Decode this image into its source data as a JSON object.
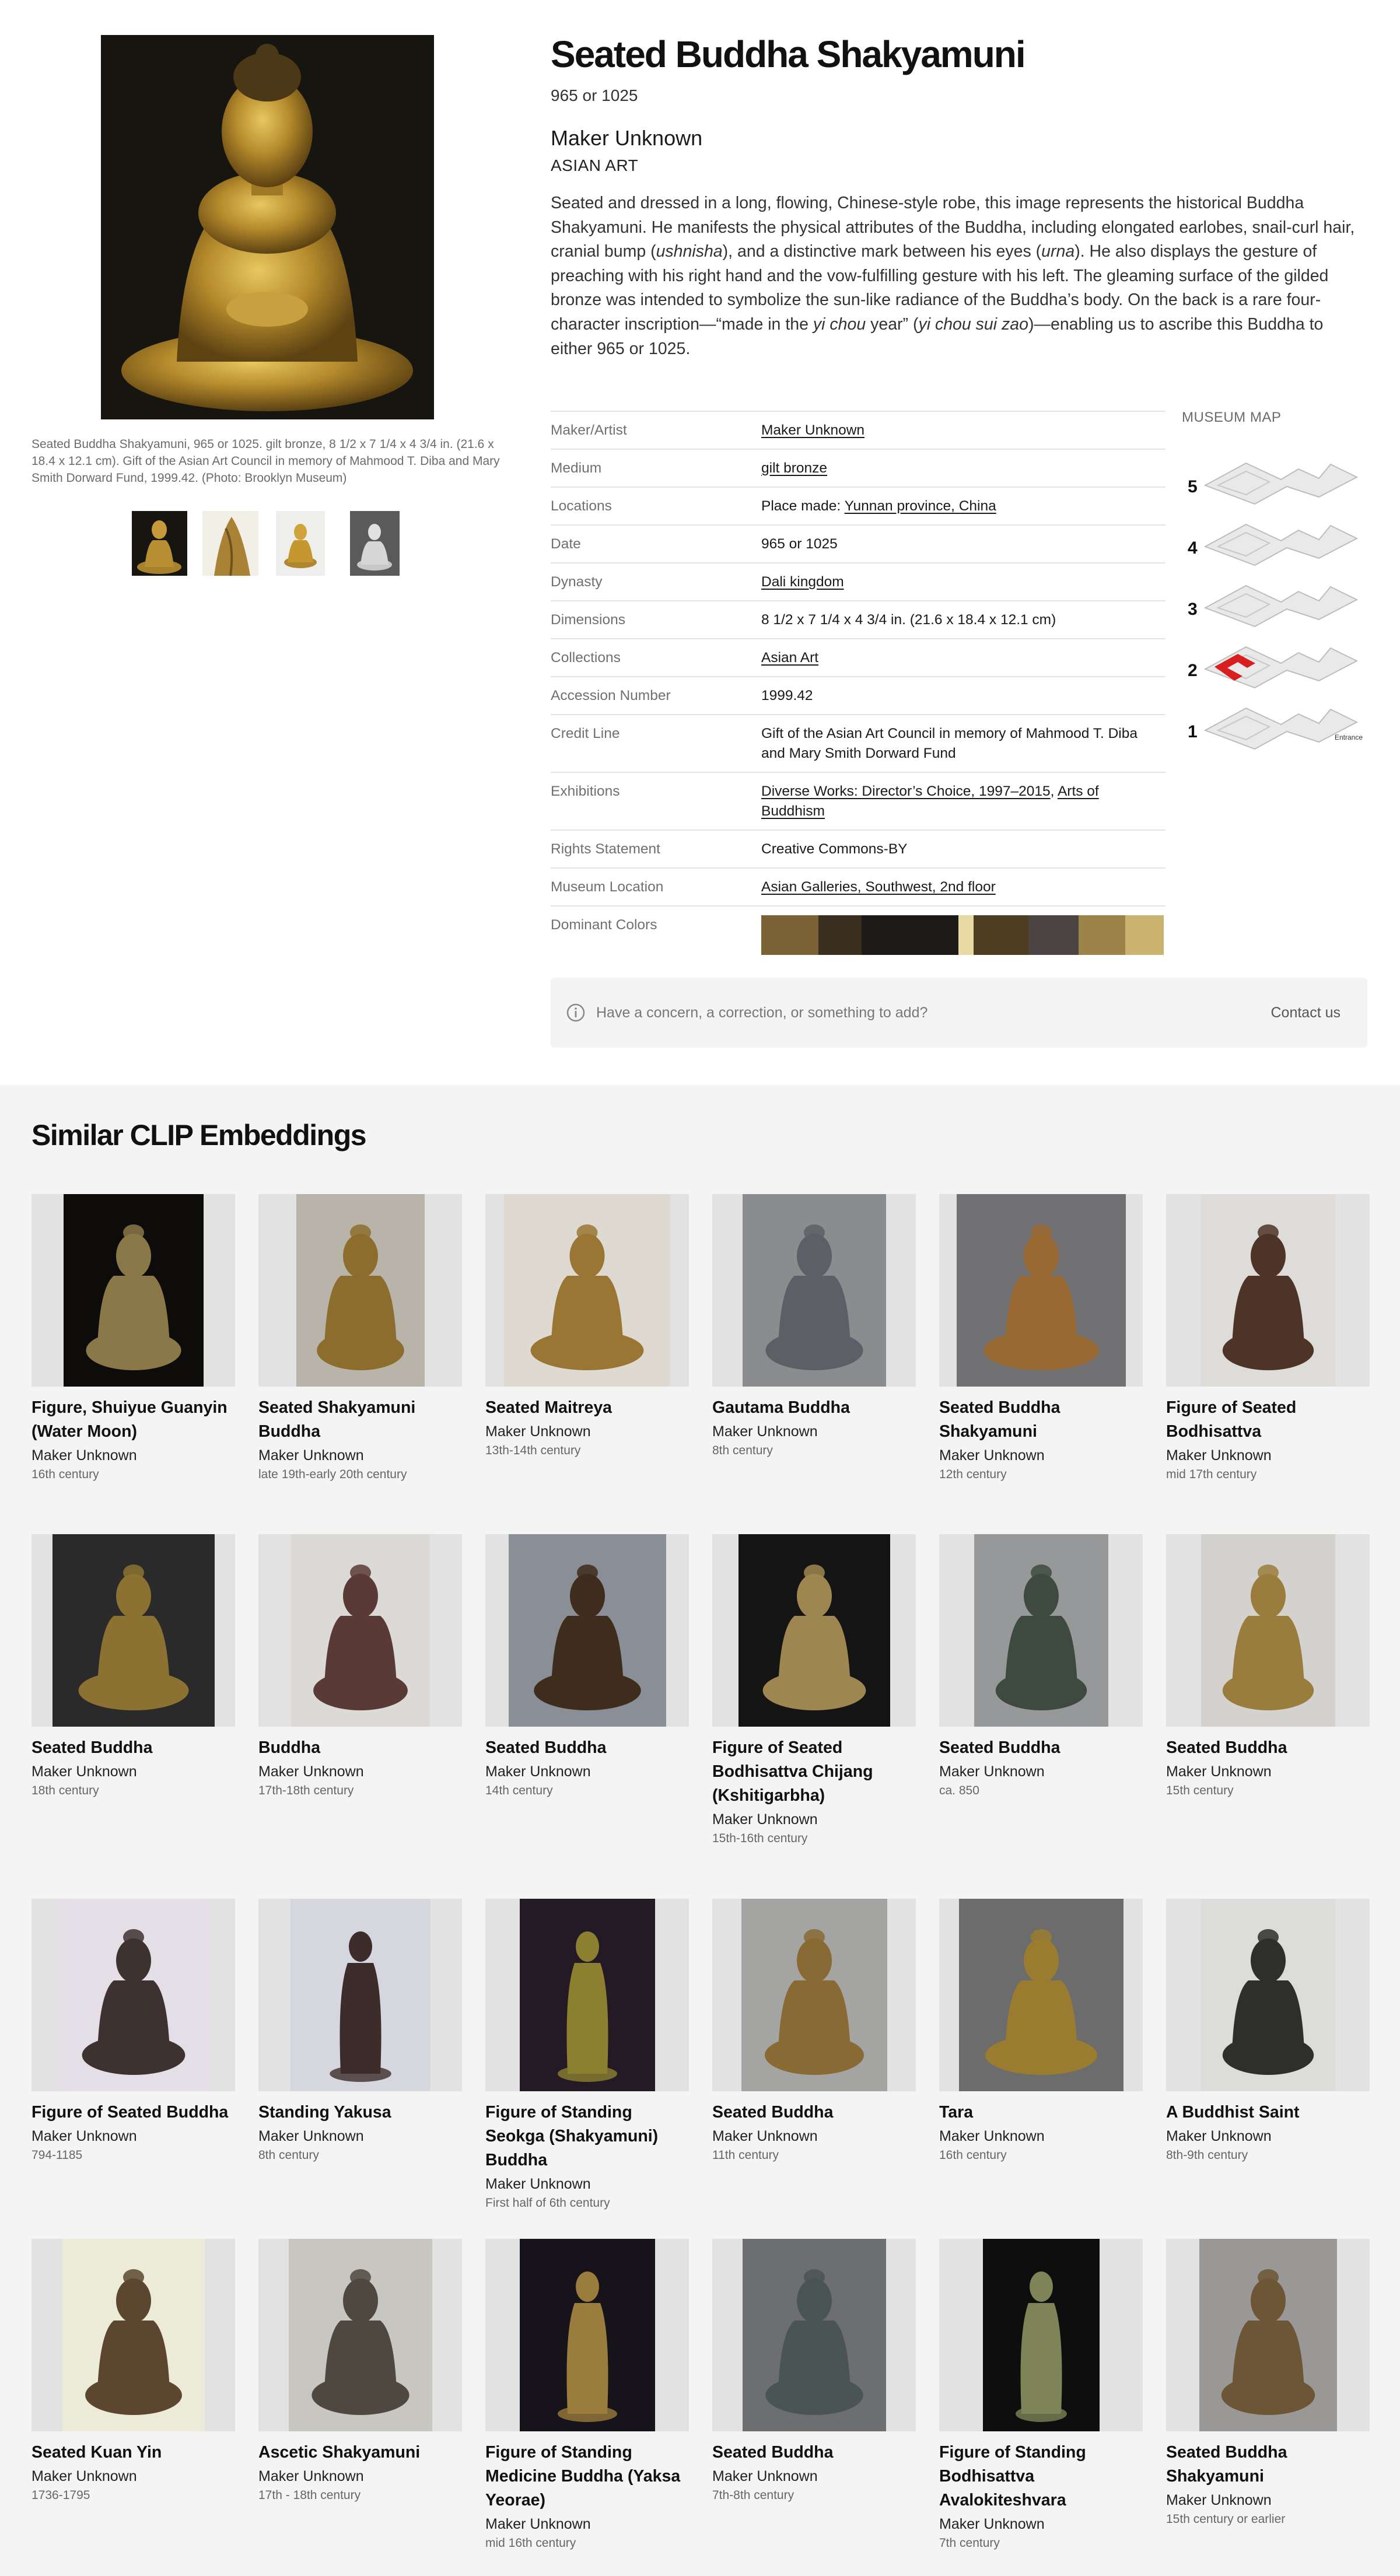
{
  "artwork": {
    "title": "Seated Buddha Shakyamuni",
    "date": "965 or 1025",
    "maker": "Maker Unknown",
    "department": "ASIAN ART",
    "description_parts": [
      {
        "t": "Seated and dressed in a long, flowing, Chinese-style robe, this image represents the historical Buddha Shakyamuni. He manifests the physical attributes of the Buddha, including elongated earlobes, snail-curl hair, cranial bump ("
      },
      {
        "t": "ushnisha",
        "i": true
      },
      {
        "t": "), and a distinctive mark between his eyes ("
      },
      {
        "t": "urna",
        "i": true
      },
      {
        "t": "). He also displays the gesture of preaching with his right hand and the vow-fulfilling gesture with his left. The gleaming surface of the gilded bronze was intended to symbolize the sun-like radiance of the Buddha’s body. On the back is a rare four-character inscription—“made in the "
      },
      {
        "t": "yi chou",
        "i": true
      },
      {
        "t": " year” ("
      },
      {
        "t": "yi chou sui zao",
        "i": true
      },
      {
        "t": ")—enabling us to ascribe this Buddha to either 965 or 1025."
      }
    ],
    "caption": "Seated Buddha Shakyamuni, 965 or 1025. gilt bronze, 8 1/2 x 7 1/4 x 4 3/4 in. (21.6 x 18.4 x 12.1 cm). Gift of the Asian Art Council in memory of Mahmood T. Diba and Mary Smith Dorward Fund, 1999.42. (Photo: Brooklyn Museum)",
    "thumbnail_count": 4
  },
  "details": [
    {
      "label": "Maker/Artist",
      "parts": [
        {
          "t": "Maker Unknown",
          "link": true
        }
      ]
    },
    {
      "label": "Medium",
      "parts": [
        {
          "t": "gilt bronze",
          "link": true
        }
      ]
    },
    {
      "label": "Locations",
      "parts": [
        {
          "t": "Place made: "
        },
        {
          "t": "Yunnan province, China",
          "link": true
        }
      ]
    },
    {
      "label": "Date",
      "parts": [
        {
          "t": "965 or 1025"
        }
      ]
    },
    {
      "label": "Dynasty",
      "parts": [
        {
          "t": "Dali kingdom",
          "link": true
        }
      ]
    },
    {
      "label": "Dimensions",
      "parts": [
        {
          "t": "8 1/2 x 7 1/4 x 4 3/4 in. (21.6 x 18.4 x 12.1 cm)"
        }
      ]
    },
    {
      "label": "Collections",
      "parts": [
        {
          "t": "Asian Art",
          "link": true
        }
      ]
    },
    {
      "label": "Accession Number",
      "parts": [
        {
          "t": "1999.42"
        }
      ]
    },
    {
      "label": "Credit Line",
      "parts": [
        {
          "t": "Gift of the Asian Art Council in memory of Mahmood T. Diba and Mary Smith Dorward Fund"
        }
      ]
    },
    {
      "label": "Exhibitions",
      "parts": [
        {
          "t": "Diverse Works: Director’s Choice, 1997–2015",
          "link": true
        },
        {
          "t": ", "
        },
        {
          "t": "Arts of Buddhism",
          "link": true
        }
      ]
    },
    {
      "label": "Rights Statement",
      "parts": [
        {
          "t": "Creative Commons-BY"
        }
      ]
    },
    {
      "label": "Museum Location",
      "parts": [
        {
          "t": "Asian Galleries, Southwest, 2nd floor",
          "link": true
        }
      ]
    },
    {
      "label": "Dominant Colors",
      "swatches": true
    }
  ],
  "dominant_colors": [
    "#7b6234",
    "#3a2e1e",
    "#1c1b17",
    "#1c1b17",
    "#e9d9a2",
    "#4f3d21",
    "#4a4442",
    "#9c8448",
    "#c9b36f"
  ],
  "museum_map": {
    "title": "MUSEUM MAP",
    "floors": [
      "5",
      "4",
      "3",
      "2",
      "1"
    ],
    "entrance_label": "Entrance",
    "highlight_floor": "2"
  },
  "concern": {
    "text": "Have a concern, a correction, or something to add?",
    "contact": "Contact us"
  },
  "similar": {
    "heading": "Similar CLIP Embeddings",
    "items": [
      {
        "title": "Figure, Shuiyue Guanyin (Water Moon)",
        "maker": "Maker Unknown",
        "date": "16th century",
        "bg": "#0d0c0a",
        "fig": "#8a7848"
      },
      {
        "title": "Seated Shakyamuni Buddha",
        "maker": "Maker Unknown",
        "date": "late 19th-early 20th century",
        "bg": "#b8b4aa",
        "fig": "#8c6d2e"
      },
      {
        "title": "Seated Maitreya",
        "maker": "Maker Unknown",
        "date": "13th-14th century",
        "bg": "#dedad2",
        "fig": "#9a7634"
      },
      {
        "title": "Gautama Buddha",
        "maker": "Maker Unknown",
        "date": "8th century",
        "bg": "#8a8c8e",
        "fig": "#5c6066"
      },
      {
        "title": "Seated Buddha Shakyamuni",
        "maker": "Maker Unknown",
        "date": "12th century",
        "bg": "#727274",
        "fig": "#9a6a34"
      },
      {
        "title": "Figure of Seated Bodhisattva",
        "maker": "Maker Unknown",
        "date": "mid 17th century",
        "bg": "#dedcd8",
        "fig": "#4e3426"
      },
      {
        "title": "Seated Buddha",
        "maker": "Maker Unknown",
        "date": "18th century",
        "bg": "#2a2a2a",
        "fig": "#8c7232"
      },
      {
        "title": "Buddha",
        "maker": "Maker Unknown",
        "date": "17th-18th century",
        "bg": "#dcdad6",
        "fig": "#5a3a36"
      },
      {
        "title": "Seated Buddha",
        "maker": "Maker Unknown",
        "date": "14th century",
        "bg": "#8a8e96",
        "fig": "#3e2c1c"
      },
      {
        "title": "Figure of Seated Bodhisattva Chijang (Kshitigarbha)",
        "maker": "Maker Unknown",
        "date": "15th-16th century",
        "bg": "#141414",
        "fig": "#9e8650"
      },
      {
        "title": "Seated Buddha",
        "maker": "Maker Unknown",
        "date": "ca. 850",
        "bg": "#96989a",
        "fig": "#3e4a40"
      },
      {
        "title": "Seated Buddha",
        "maker": "Maker Unknown",
        "date": "15th century",
        "bg": "#d4d2ce",
        "fig": "#9a7c3c"
      },
      {
        "title": "Figure of Seated Buddha",
        "maker": "Maker Unknown",
        "date": "794-1185",
        "bg": "#e4dee6",
        "fig": "#3e3230"
      },
      {
        "title": "Standing Yakusa",
        "maker": "Maker Unknown",
        "date": "8th century",
        "bg": "#d6d6de",
        "fig": "#3c2c2a"
      },
      {
        "title": "Figure of Standing Seokga (Shakyamuni) Buddha",
        "maker": "Maker Unknown",
        "date": "First half of 6th century",
        "bg": "#241a26",
        "fig": "#8c8030"
      },
      {
        "title": "Seated Buddha",
        "maker": "Maker Unknown",
        "date": "11th century",
        "bg": "#a4a4a2",
        "fig": "#8a6a34"
      },
      {
        "title": "Tara",
        "maker": "Maker Unknown",
        "date": "16th century",
        "bg": "#6c6c6c",
        "fig": "#9a7c30"
      },
      {
        "title": "A Buddhist Saint",
        "maker": "Maker Unknown",
        "date": "8th-9th century",
        "bg": "#dcdcda",
        "fig": "#2e2e2a"
      },
      {
        "title": "Seated Kuan Yin",
        "maker": "Maker Unknown",
        "date": "1736-1795",
        "bg": "#ecebd8",
        "fig": "#5c4630"
      },
      {
        "title": "Ascetic Shakyamuni",
        "maker": "Maker Unknown",
        "date": "17th - 18th century",
        "bg": "#c8c6c0",
        "fig": "#4e4840"
      },
      {
        "title": "Figure of Standing Medicine Buddha (Yaksa Yeorae)",
        "maker": "Maker Unknown",
        "date": "mid 16th century",
        "bg": "#16141a",
        "fig": "#9a7c3c"
      },
      {
        "title": "Seated Buddha",
        "maker": "Maker Unknown",
        "date": "7th-8th century",
        "bg": "#6c6e70",
        "fig": "#4a5454"
      },
      {
        "title": "Figure of Standing Bodhisattva Avalokiteshvara",
        "maker": "Maker Unknown",
        "date": "7th century",
        "bg": "#0e0e0e",
        "fig": "#7e8458"
      },
      {
        "title": "Seated Buddha Shakyamuni",
        "maker": "Maker Unknown",
        "date": "15th century or earlier",
        "bg": "#9a9896",
        "fig": "#6c5636"
      }
    ]
  }
}
